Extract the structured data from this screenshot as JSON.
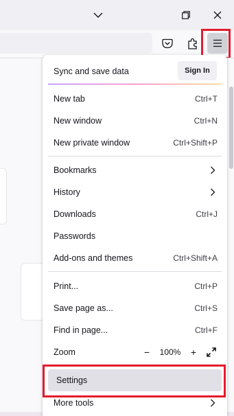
{
  "titlebar": {
    "icons": [
      "chevron-down-icon",
      "restore-icon",
      "close-icon"
    ]
  },
  "toolbar": {
    "icons": [
      "pocket-icon",
      "extensions-icon",
      "hamburger-menu-icon"
    ]
  },
  "menu": {
    "sync": {
      "label": "Sync and save data",
      "sign_in": "Sign In"
    },
    "new_tab": {
      "label": "New tab",
      "shortcut": "Ctrl+T"
    },
    "new_window": {
      "label": "New window",
      "shortcut": "Ctrl+N"
    },
    "new_private": {
      "label": "New private window",
      "shortcut": "Ctrl+Shift+P"
    },
    "bookmarks": {
      "label": "Bookmarks"
    },
    "history": {
      "label": "History"
    },
    "downloads": {
      "label": "Downloads",
      "shortcut": "Ctrl+J"
    },
    "passwords": {
      "label": "Passwords"
    },
    "addons": {
      "label": "Add-ons and themes",
      "shortcut": "Ctrl+Shift+A"
    },
    "print": {
      "label": "Print...",
      "shortcut": "Ctrl+P"
    },
    "save_page": {
      "label": "Save page as...",
      "shortcut": "Ctrl+S"
    },
    "find": {
      "label": "Find in page...",
      "shortcut": "Ctrl+F"
    },
    "zoom": {
      "label": "Zoom",
      "minus": "−",
      "value": "100%",
      "plus": "+"
    },
    "settings": {
      "label": "Settings"
    },
    "more_tools": {
      "label": "More tools"
    }
  },
  "colors": {
    "highlight_red": "#e21b2c",
    "hover_bg": "#e0e0e6"
  }
}
